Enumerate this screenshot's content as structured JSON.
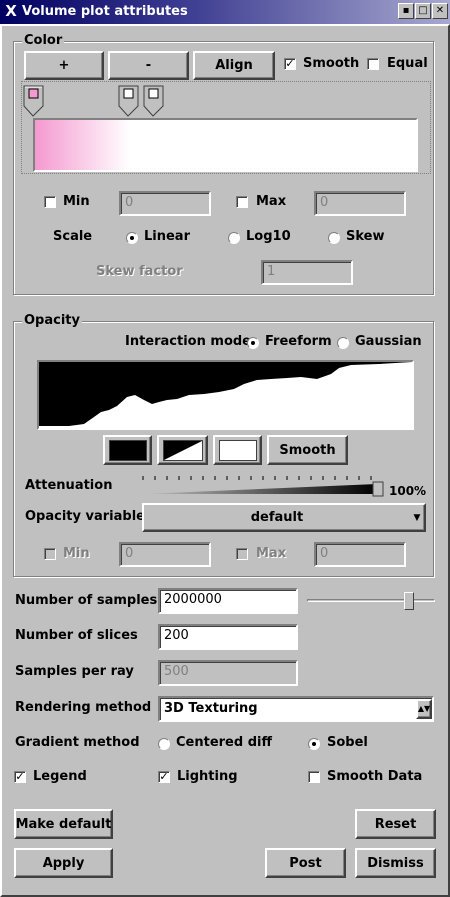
{
  "window": {
    "title": "Volume plot attributes",
    "buttons": [
      "▪",
      "□",
      "✕"
    ]
  },
  "color": {
    "group_title": "Color",
    "plus_label": "+",
    "minus_label": "-",
    "align_label": "Align",
    "smooth_label": "Smooth",
    "smooth_checked": true,
    "equal_label": "Equal",
    "equal_checked": false,
    "gradient_start": "#f599d0",
    "gradient_end": "#ffffff",
    "min_label": "Min",
    "min_value": "0",
    "max_label": "Max",
    "max_value": "0",
    "scale_label": "Scale",
    "scale_options": [
      "Linear",
      "Log10",
      "Skew"
    ],
    "scale_selected": "Linear",
    "skew_label": "Skew factor",
    "skew_value": "1"
  },
  "opacity": {
    "group_title": "Opacity",
    "interaction_label": "Interaction mode",
    "interaction_options": [
      "Freeform",
      "Gaussian"
    ],
    "interaction_selected": "Freeform",
    "smooth_label": "Smooth",
    "attenuation_label": "Attenuation",
    "attenuation_value": "100%",
    "attenuation_fraction": 1.0,
    "variable_label": "Opacity variable",
    "variable_value": "default",
    "min_label": "Min",
    "min_value": "0",
    "max_label": "Max",
    "max_value": "0"
  },
  "render": {
    "samples_label": "Number of samples",
    "samples_value": "2000000",
    "samples_slider_fraction": 0.82,
    "slices_label": "Number of slices",
    "slices_value": "200",
    "samples_per_ray_label": "Samples per ray",
    "samples_per_ray_value": "500",
    "method_label": "Rendering method",
    "method_value": "3D Texturing",
    "gradient_label": "Gradient method",
    "gradient_options": [
      "Centered diff",
      "Sobel"
    ],
    "gradient_selected": "Sobel",
    "legend_label": "Legend",
    "legend_checked": true,
    "lighting_label": "Lighting",
    "lighting_checked": true,
    "smooth_data_label": "Smooth Data",
    "smooth_data_checked": false
  },
  "actions": {
    "make_default_label": "Make default",
    "reset_label": "Reset",
    "apply_label": "Apply",
    "post_label": "Post",
    "dismiss_label": "Dismiss"
  }
}
